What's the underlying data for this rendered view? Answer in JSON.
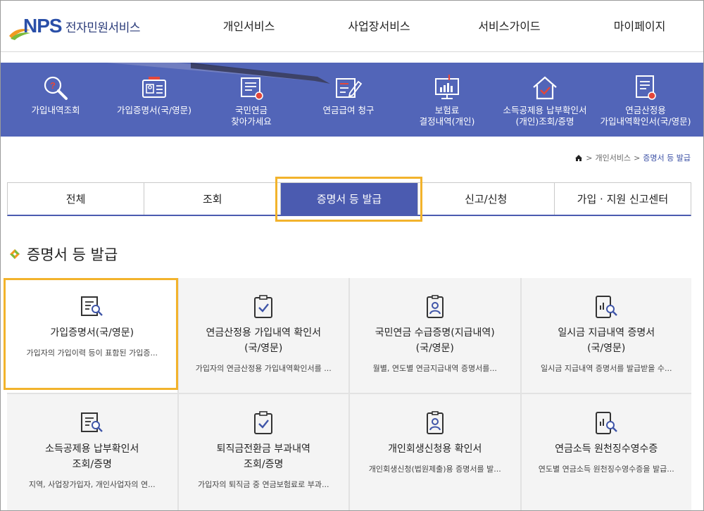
{
  "header": {
    "logo_mark": "NPS",
    "logo_text": "전자민원서비스",
    "nav": [
      "개인서비스",
      "사업장서비스",
      "서비스가이드",
      "마이페이지"
    ]
  },
  "quick_menu": [
    {
      "label": "가입내역조회",
      "icon": "magnifier-icon"
    },
    {
      "label": "가입증명서(국/영문)",
      "icon": "id-card-icon"
    },
    {
      "label": "국민연금\n찾아가세요",
      "icon": "document-search-icon"
    },
    {
      "label": "연금급여 청구",
      "icon": "form-pen-icon"
    },
    {
      "label": "보험료\n결정내역(개인)",
      "icon": "monitor-chart-icon"
    },
    {
      "label": "소득공제용 납부확인서\n(개인)조회/증명",
      "icon": "house-check-icon"
    },
    {
      "label": "연금산정용\n가입내역확인서(국/영문)",
      "icon": "document-search-icon"
    }
  ],
  "breadcrumb": {
    "items": [
      "개인서비스",
      "증명서 등 발급"
    ]
  },
  "tabs": [
    "전체",
    "조회",
    "증명서 등 발급",
    "신고/신청",
    "가입 · 지원 신고센터"
  ],
  "active_tab": 2,
  "section_title": "증명서 등 발급",
  "cards": [
    {
      "title": "가입증명서(국/영문)",
      "desc": "가입자의 가입이력 등이 표함된 가입증...",
      "icon": "document-search-icon"
    },
    {
      "title": "연금산정용 가입내역 확인서\n(국/영문)",
      "desc": "가입자의 연금산정용 가입내역확인서를 ...",
      "icon": "clipboard-check-icon"
    },
    {
      "title": "국민연금 수급증명(지급내역)\n(국/영문)",
      "desc": "월별, 연도별 연금지급내역 증명서를...",
      "icon": "id-badge-icon"
    },
    {
      "title": "일시금 지급내역 증명서\n(국/영문)",
      "desc": "일시금 지급내역 증명서를 발급받을 수...",
      "icon": "tablet-search-icon"
    },
    {
      "title": "소득공제용 납부확인서\n조회/증명",
      "desc": "지역, 사업장가입자, 개인사업자의 연...",
      "icon": "document-search-icon"
    },
    {
      "title": "퇴직금전환금 부과내역\n조회/증명",
      "desc": "가입자의 퇴직금 중 연금보험료로 부과...",
      "icon": "clipboard-check-icon"
    },
    {
      "title": "개인회생신청용 확인서",
      "desc": "개인회생신청(법원제출)용 증명서를 발...",
      "icon": "id-badge-icon"
    },
    {
      "title": "연금소득 원천징수영수증",
      "desc": "연도별 연금소득 원천징수영수증을 발급...",
      "icon": "tablet-search-icon"
    }
  ],
  "colors": {
    "brand_blue": "#4b5bb0",
    "banner_blue": "#5265b8",
    "highlight": "#f2b32c"
  }
}
